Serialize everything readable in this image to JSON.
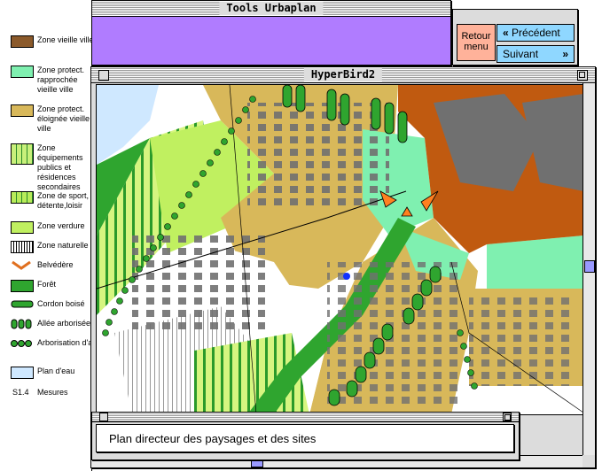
{
  "tools_window": {
    "title": "Tools Urbaplan"
  },
  "map_window": {
    "title": "HyperBird2"
  },
  "nav": {
    "back_label_line1": "Retour",
    "back_label_line2": "menu",
    "previous_label": "Précédent",
    "next_label": "Suivant"
  },
  "caption": {
    "text": "Plan directeur des paysages et des sites"
  },
  "legend": {
    "items": [
      {
        "label": "Zone vieille ville",
        "color": "#8b5a2b",
        "icon": "fill-swatch"
      },
      {
        "label": "Zone protect. rapprochée vieille ville",
        "color": "#7ff0b0",
        "icon": "fill-swatch"
      },
      {
        "label": "Zone protect. éloignée vieille ville",
        "color": "#d8b85a",
        "icon": "fill-swatch"
      },
      {
        "label": "Zone équipements publics et résidences secondaires",
        "color": "#c8f07a",
        "icon": "striped-swatch"
      },
      {
        "label": "Zone de sport, détente,loisir",
        "color": "#b8ec5a",
        "icon": "striped-swatch"
      },
      {
        "label": "Zone verdure",
        "color": "#c0f060",
        "icon": "fill-swatch"
      },
      {
        "label": "Zone naturelle",
        "color": "#ffffff",
        "icon": "striped-swatch"
      },
      {
        "label": "Belvédère",
        "color": "#e07020",
        "icon": "belvedere-icon"
      },
      {
        "label": "Forêt",
        "color": "#2fa52f",
        "icon": "fill-swatch"
      },
      {
        "label": "Cordon boisé",
        "color": "#2fa52f",
        "icon": "cordon-icon"
      },
      {
        "label": "Allée arborisée",
        "color": "#2fa52f",
        "icon": "allee-icon"
      },
      {
        "label": "Arborisation d'accompagnement",
        "color": "#2fa52f",
        "icon": "dots-icon"
      },
      {
        "label": "Plan d'eau",
        "color": "#cfe8ff",
        "icon": "fill-swatch"
      },
      {
        "label": "Mesures",
        "code": "S1.4",
        "icon": "code-label"
      }
    ]
  },
  "colors": {
    "tools_body": "#b07cff",
    "old_town": "#c05a10",
    "buildings": "#707070",
    "protect_far": "#d8b85a",
    "protect_near": "#7ff0b0",
    "forest": "#2fa52f",
    "verdure": "#c0f060",
    "water": "#cfe8ff"
  }
}
